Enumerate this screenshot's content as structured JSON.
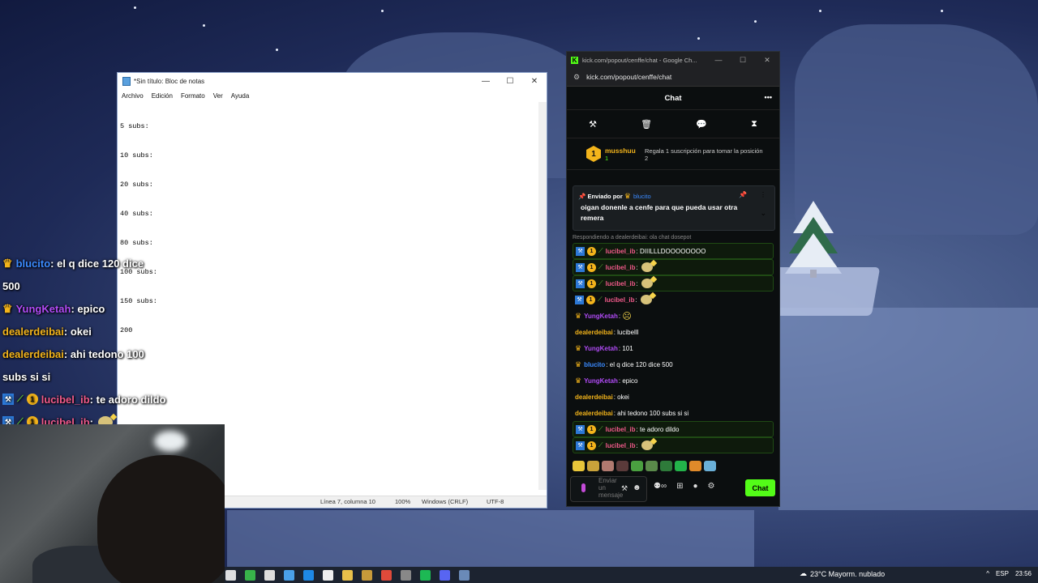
{
  "notepad": {
    "title": "*Sin título: Bloc de notas",
    "menu": [
      "Archivo",
      "Edición",
      "Formato",
      "Ver",
      "Ayuda"
    ],
    "lines": [
      "5 subs:",
      "10 subs:",
      "20 subs:",
      "40 subs:",
      "80 subs:",
      "100 subs:",
      "150 subs:",
      "200"
    ],
    "status": {
      "position": "Línea 7, columna 10",
      "zoom": "100%",
      "eol": "Windows (CRLF)",
      "encoding": "UTF-8"
    }
  },
  "kick": {
    "window_title": "kick.com/popout/cenffe/chat - Google Ch...",
    "url": "kick.com/popout/cenffe/chat",
    "header": "Chat",
    "leader": {
      "name": "musshuu",
      "count": "1",
      "gift_text": "Regala 1 suscripción para tomar la posición 2"
    },
    "pinned": {
      "by_label": "Enviado por",
      "by_user": "blucito",
      "message": "oigan donenle a cenfe para que pueda usar otra remera"
    },
    "reply": "Respondiendo a dealerdeibai: ola chat dosepot",
    "messages": [
      {
        "user": "lucibel_ib",
        "text": "DIIILLLDOOOOOOOO",
        "color": "#f15a8a",
        "badges": "sub",
        "hl": true
      },
      {
        "user": "lucibel_ib",
        "text": "",
        "color": "#f15a8a",
        "badges": "sub",
        "hl": true,
        "emote": true
      },
      {
        "user": "lucibel_ib",
        "text": "",
        "color": "#f15a8a",
        "badges": "sub",
        "hl": true,
        "emote": true
      },
      {
        "user": "lucibel_ib",
        "text": "",
        "color": "#f15a8a",
        "badges": "sub",
        "hl": false,
        "emote": true
      },
      {
        "user": "YungKetah",
        "text": "",
        "color": "#b04bf5",
        "badges": "crown",
        "hl": false,
        "face": true
      },
      {
        "user": "dealerdeibai",
        "text": "lucibelll",
        "color": "#f3b41b",
        "badges": "",
        "hl": false
      },
      {
        "user": "YungKetah",
        "text": "101",
        "color": "#b04bf5",
        "badges": "crown",
        "hl": false
      },
      {
        "user": "blucito",
        "text": "el q dice 120 dice 500",
        "color": "#3b8bff",
        "badges": "crown",
        "hl": false
      },
      {
        "user": "YungKetah",
        "text": "epico",
        "color": "#b04bf5",
        "badges": "crown",
        "hl": false
      },
      {
        "user": "dealerdeibai",
        "text": "okei",
        "color": "#f3b41b",
        "badges": "",
        "hl": false
      },
      {
        "user": "dealerdeibai",
        "text": "ahi tedono 100 subs si si",
        "color": "#f3b41b",
        "badges": "",
        "hl": false
      },
      {
        "user": "lucibel_ib",
        "text": "te adoro dildo",
        "color": "#f15a8a",
        "badges": "sub",
        "hl": true
      },
      {
        "user": "lucibel_ib",
        "text": "",
        "color": "#f15a8a",
        "badges": "sub",
        "hl": true,
        "emote": true
      }
    ],
    "input_placeholder": "Enviar un mensaje",
    "send_label": "Chat"
  },
  "overlay": [
    {
      "user": "blucito",
      "text": ": el q dice 120 dice",
      "color": "#3b8bff",
      "badges": "crown"
    },
    {
      "user": "",
      "text": "500",
      "color": "#ffffff",
      "badges": ""
    },
    {
      "user": "YungKetah",
      "text": ": epico",
      "color": "#b04bf5",
      "badges": "crown"
    },
    {
      "user": "dealerdeibai",
      "text": ": okei",
      "color": "#f3b41b",
      "badges": ""
    },
    {
      "user": "dealerdeibai",
      "text": ": ahi tedono 100",
      "color": "#f3b41b",
      "badges": ""
    },
    {
      "user": "",
      "text": "subs si si",
      "color": "#ffffff",
      "badges": ""
    },
    {
      "user": "lucibel_ib",
      "text": ": te adoro dildo",
      "color": "#f15a8a",
      "badges": "sub"
    },
    {
      "user": "lucibel_ib",
      "text": ":",
      "color": "#f15a8a",
      "badges": "sub",
      "emote": true
    }
  ],
  "taskbar": {
    "weather": "23°C  Mayorm. nublado",
    "lang": "ESP",
    "time": "23:56"
  }
}
